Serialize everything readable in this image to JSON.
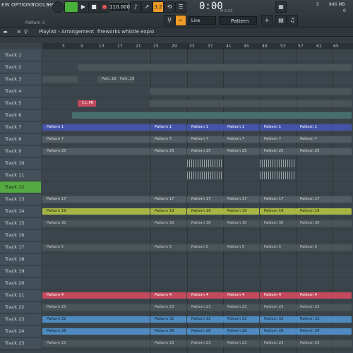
{
  "menu": [
    "EW",
    "OPTIONS",
    "TOOLS",
    "HELP"
  ],
  "pattern_label": "Pattern 3",
  "transport": {
    "tempo": "110.000",
    "time": "0:00",
    "time_sub": "00",
    "mcs": "M:S:CS",
    "mode": "3.2"
  },
  "pattern_selector": "Pattern 41",
  "snap": "Line",
  "cpu": {
    "left": "5",
    "right": "846 MB",
    "sub": "0"
  },
  "playlist": {
    "title": "Playlist - Arrangement",
    "song": "fireworks whistle explo"
  },
  "ruler": [
    "5",
    "9",
    "13",
    "17",
    "21",
    "25",
    "29",
    "33",
    "37",
    "41",
    "45",
    "49",
    "53",
    "57",
    "61",
    "65"
  ],
  "tracks": [
    "Track 1",
    "Track 2",
    "Track 3",
    "Track 4",
    "Track 5",
    "Track 6",
    "Track 7",
    "Track 8",
    "Track 9",
    "Track 10",
    "Track 11",
    "Track 12",
    "Track 13",
    "Track 14",
    "Track 15",
    "Track 16",
    "Track 17",
    "Track 18",
    "Track 19",
    "Track 20",
    "Track 21",
    "Track 22",
    "Track 23",
    "Track 24",
    "Track 25"
  ],
  "selected_track": "Track 12",
  "clips": {
    "t7": "Pattern 1",
    "t8": "Pattern 7",
    "t9": "Pattern 25",
    "t13": "Pattern 17",
    "t14": "Pattern 19",
    "t15": "Pattern 30",
    "t17": "Pattern 5",
    "t21": "Pattern 4",
    "t22": "Pattern 23",
    "t23": "Pattern 32",
    "t24": "Pattern 28",
    "t25": "Pattern 23",
    "t3a": "Patt..18",
    "t3b": "Patt..18",
    "t5": "Cy..PR"
  }
}
